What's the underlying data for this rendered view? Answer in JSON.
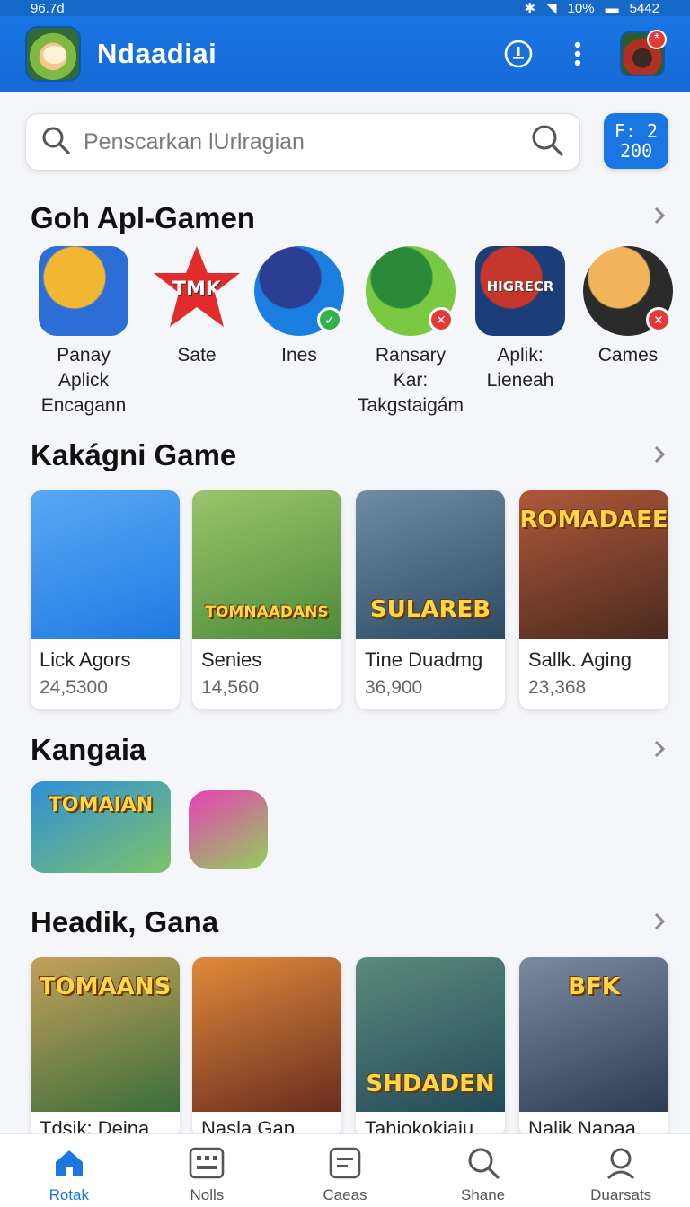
{
  "status_bar": {
    "left": "96.7d",
    "battery": "10%",
    "time": "5442"
  },
  "app_bar": {
    "title": "Ndaadiai",
    "logo_icon": "hamster-logo-icon",
    "actions": [
      "info-icon",
      "more-vert-icon"
    ],
    "notification_badge": "*"
  },
  "search": {
    "placeholder": "Penscarkan lUrlragian"
  },
  "scan_button": {
    "line1": "F: 2",
    "line2": "200"
  },
  "sections": [
    {
      "title": "Goh Apl-Gamen"
    },
    {
      "title": "Kakágni Game"
    },
    {
      "title": "Kangaia"
    },
    {
      "title": "Headik, Gana"
    }
  ],
  "circle_apps": [
    {
      "line1": "Panay Aplick",
      "line2": "Encagann",
      "icon": "gamepad-icon",
      "colors": [
        "#2b6fd6",
        "#f2b632"
      ]
    },
    {
      "line1": "Sate",
      "line2": "",
      "icon": "star-badge-icon",
      "tile_text": "TMK",
      "colors": [
        "#e32b2b",
        "#ffffff"
      ]
    },
    {
      "line1": "Ines",
      "line2": "",
      "icon": "send-icon",
      "colors": [
        "#1a7fe0",
        "#2c3e91"
      ],
      "badge": "✓"
    },
    {
      "line1": "Ransary Kar:",
      "line2": "Takgstaigám",
      "icon": "dino-icon",
      "colors": [
        "#7ac943",
        "#2a8a3a"
      ],
      "badge": "✕"
    },
    {
      "line1": "Aplik:",
      "line2": "Lieneah",
      "icon": "heroes-icon",
      "tile_text": "HIGRECR",
      "colors": [
        "#1b3d7a",
        "#c4372a"
      ]
    },
    {
      "line1": "Cames",
      "line2": "",
      "icon": "hamster-icon",
      "colors": [
        "#2b2b2b",
        "#f2b45a"
      ],
      "badge": "✕"
    }
  ],
  "section2_cards": [
    {
      "name": "Lick Agors",
      "count": "24,5300",
      "thumb_text": "",
      "colors": [
        "#1f7ae0",
        "#5aa8f5"
      ]
    },
    {
      "name": "Senies",
      "count": "14,560",
      "thumb_text": "TOMNAADANS",
      "colors": [
        "#4e8b3a",
        "#9bc46b"
      ]
    },
    {
      "name": "Tine Duadmg",
      "count": "36,900",
      "thumb_text": "SULAREB",
      "colors": [
        "#2c4a63",
        "#6f8ca3"
      ]
    },
    {
      "name": "Sallk. Aging",
      "count": "23,368",
      "thumb_text": "ROMADAEE",
      "colors": [
        "#4a2a1f",
        "#b0583a"
      ]
    }
  ],
  "section3_tiles": [
    {
      "text": "TOMAIAN",
      "colors": [
        "#2f8fd8",
        "#7cc36a"
      ]
    },
    {
      "text": "",
      "colors": [
        "#e83fb5",
        "#8fd15a"
      ]
    }
  ],
  "section4_cards": [
    {
      "name": "Tdsik: Deina",
      "thumb_text": "TOMAANS",
      "colors": [
        "#3b6e3a",
        "#c3a05a"
      ]
    },
    {
      "name": "Nasla Gap",
      "thumb_text": "",
      "colors": [
        "#6a2c1f",
        "#e08a3a"
      ]
    },
    {
      "name": "Tahiokokiaiu",
      "thumb_text": "SHDADEN",
      "colors": [
        "#224a5a",
        "#5c8a7a"
      ]
    },
    {
      "name": "Nalik Napaa",
      "thumb_text": "BFK",
      "colors": [
        "#2c3c52",
        "#7a8aa0"
      ]
    }
  ],
  "bottom_nav": [
    {
      "label": "Rotak",
      "icon": "home-icon",
      "active": true
    },
    {
      "label": "Nolls",
      "icon": "apps-grid-icon",
      "active": false
    },
    {
      "label": "Caeas",
      "icon": "categories-icon",
      "active": false
    },
    {
      "label": "Shane",
      "icon": "search-icon",
      "active": false
    },
    {
      "label": "Duarsats",
      "icon": "account-icon",
      "active": false
    }
  ]
}
